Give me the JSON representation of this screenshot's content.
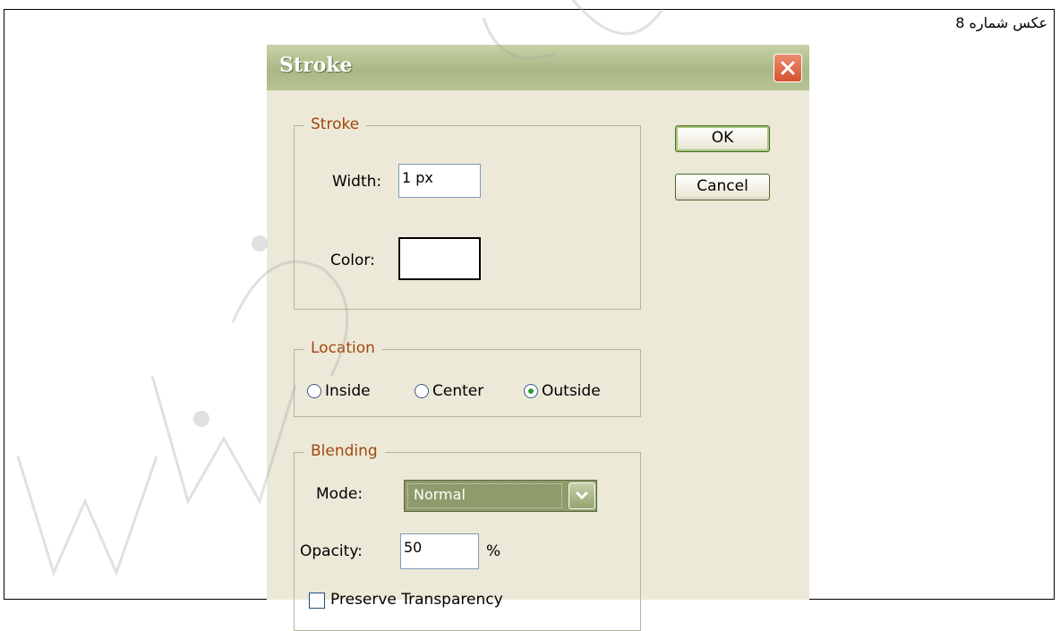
{
  "caption": "عکس شماره 8",
  "dialog": {
    "title": "Stroke",
    "stroke_group": {
      "legend": "Stroke",
      "width_label": "Width:",
      "width_value": "1 px",
      "color_label": "Color:",
      "color_value": "#ffffff"
    },
    "location_group": {
      "legend": "Location",
      "options": [
        "Inside",
        "Center",
        "Outside"
      ],
      "selected": "Outside"
    },
    "blending_group": {
      "legend": "Blending",
      "mode_label": "Mode:",
      "mode_value": "Normal",
      "opacity_label": "Opacity:",
      "opacity_value": "50",
      "opacity_unit": "%",
      "preserve_label": "Preserve Transparency",
      "preserve_checked": false
    },
    "ok_label": "OK",
    "cancel_label": "Cancel"
  },
  "colors": {
    "dialog_bg": "#ece9d8",
    "titlebar": "#a9b785",
    "legend_text": "#a2460c",
    "close_button": "#d4532f",
    "mode_select": "#8f9b6b"
  },
  "icons": [
    "close-icon",
    "dropdown-arrow-icon",
    "radio-icon",
    "checkbox-icon"
  ]
}
